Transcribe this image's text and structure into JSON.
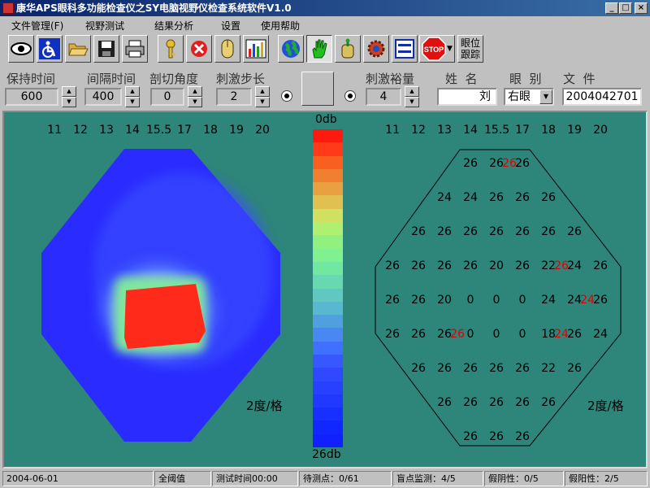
{
  "window": {
    "title": "康华APS眼科多功能检查仪之SY电脑视野仪检查系统软件V1.0",
    "minimize": "_",
    "maximize": "□",
    "close": "×"
  },
  "menu": [
    "文件管理(F)",
    "视野测试",
    "结果分析",
    "设置",
    "使用帮助"
  ],
  "toolbar": {
    "icons": [
      "eye-icon",
      "accessibility-icon",
      "open-folder-icon",
      "save-disk-icon",
      "printer-icon",
      "key-icon",
      "stop-circle-icon",
      "mouse-icon",
      "bar-chart-icon",
      "globe-icon",
      "hand-icon",
      "joystick-icon",
      "gear-icon",
      "list-icon",
      "stop-sign-icon"
    ],
    "stop_label": "STOP",
    "eye_track_label": "眼位\n跟踪"
  },
  "params": {
    "hold_time": {
      "label": "保持时间",
      "value": "600"
    },
    "interval_time": {
      "label": "间隔时间",
      "value": "400"
    },
    "cut_angle": {
      "label": "剖切角度",
      "value": "0"
    },
    "stim_step": {
      "label": "刺激步长",
      "value": "2"
    },
    "stim_margin": {
      "label": "刺激裕量",
      "value": "4"
    },
    "name": {
      "label": "姓  名",
      "value": "刘"
    },
    "eye": {
      "label": "眼  别",
      "value": "右眼"
    },
    "file": {
      "label": "文  件",
      "value": "2004042701"
    }
  },
  "chart": {
    "scale_top": "0db",
    "scale_bottom": "26db",
    "unit_label": "2度/格",
    "column_labels": [
      "11",
      "12",
      "13",
      "14",
      "15.5",
      "17",
      "18",
      "19",
      "20"
    ],
    "colors": {
      "background": "#2e857a",
      "field": "#1e3cff",
      "defect": "#ff2a1a"
    }
  },
  "values": [
    {
      "c": 3,
      "r": 0,
      "t": "26"
    },
    {
      "c": 4,
      "r": 0,
      "t": "26"
    },
    {
      "c": 4.5,
      "r": 0,
      "t": "26",
      "red": true
    },
    {
      "c": 5,
      "r": 0,
      "t": "26"
    },
    {
      "c": 2,
      "r": 1,
      "t": "24"
    },
    {
      "c": 3,
      "r": 1,
      "t": "24"
    },
    {
      "c": 4,
      "r": 1,
      "t": "26"
    },
    {
      "c": 5,
      "r": 1,
      "t": "26"
    },
    {
      "c": 6,
      "r": 1,
      "t": "26"
    },
    {
      "c": 1,
      "r": 2,
      "t": "26"
    },
    {
      "c": 2,
      "r": 2,
      "t": "26"
    },
    {
      "c": 3,
      "r": 2,
      "t": "26"
    },
    {
      "c": 4,
      "r": 2,
      "t": "26"
    },
    {
      "c": 5,
      "r": 2,
      "t": "26"
    },
    {
      "c": 6,
      "r": 2,
      "t": "26"
    },
    {
      "c": 7,
      "r": 2,
      "t": "26"
    },
    {
      "c": 0,
      "r": 3,
      "t": "26"
    },
    {
      "c": 1,
      "r": 3,
      "t": "26"
    },
    {
      "c": 2,
      "r": 3,
      "t": "26"
    },
    {
      "c": 3,
      "r": 3,
      "t": "26"
    },
    {
      "c": 4,
      "r": 3,
      "t": "20"
    },
    {
      "c": 5,
      "r": 3,
      "t": "26"
    },
    {
      "c": 6,
      "r": 3,
      "t": "22"
    },
    {
      "c": 6.5,
      "r": 3,
      "t": "26",
      "red": true
    },
    {
      "c": 7,
      "r": 3,
      "t": "24"
    },
    {
      "c": 8,
      "r": 3,
      "t": "26"
    },
    {
      "c": 0,
      "r": 4,
      "t": "26"
    },
    {
      "c": 1,
      "r": 4,
      "t": "26"
    },
    {
      "c": 2,
      "r": 4,
      "t": "20"
    },
    {
      "c": 3,
      "r": 4,
      "t": "0"
    },
    {
      "c": 4,
      "r": 4,
      "t": "0"
    },
    {
      "c": 5,
      "r": 4,
      "t": "0"
    },
    {
      "c": 6,
      "r": 4,
      "t": "24"
    },
    {
      "c": 7,
      "r": 4,
      "t": "24"
    },
    {
      "c": 7.5,
      "r": 4,
      "t": "24",
      "red": true
    },
    {
      "c": 8,
      "r": 4,
      "t": "26"
    },
    {
      "c": 0,
      "r": 5,
      "t": "26"
    },
    {
      "c": 1,
      "r": 5,
      "t": "26"
    },
    {
      "c": 2,
      "r": 5,
      "t": "26"
    },
    {
      "c": 2.5,
      "r": 5,
      "t": "26",
      "red": true
    },
    {
      "c": 3,
      "r": 5,
      "t": "0"
    },
    {
      "c": 4,
      "r": 5,
      "t": "0"
    },
    {
      "c": 5,
      "r": 5,
      "t": "0"
    },
    {
      "c": 6,
      "r": 5,
      "t": "18"
    },
    {
      "c": 6.5,
      "r": 5,
      "t": "24",
      "red": true
    },
    {
      "c": 7,
      "r": 5,
      "t": "26"
    },
    {
      "c": 8,
      "r": 5,
      "t": "24"
    },
    {
      "c": 1,
      "r": 6,
      "t": "26"
    },
    {
      "c": 2,
      "r": 6,
      "t": "26"
    },
    {
      "c": 3,
      "r": 6,
      "t": "26"
    },
    {
      "c": 4,
      "r": 6,
      "t": "26"
    },
    {
      "c": 5,
      "r": 6,
      "t": "26"
    },
    {
      "c": 6,
      "r": 6,
      "t": "22"
    },
    {
      "c": 7,
      "r": 6,
      "t": "26"
    },
    {
      "c": 2,
      "r": 7,
      "t": "26"
    },
    {
      "c": 3,
      "r": 7,
      "t": "26"
    },
    {
      "c": 4,
      "r": 7,
      "t": "26"
    },
    {
      "c": 5,
      "r": 7,
      "t": "26"
    },
    {
      "c": 6,
      "r": 7,
      "t": "26"
    },
    {
      "c": 3,
      "r": 8,
      "t": "26"
    },
    {
      "c": 4,
      "r": 8,
      "t": "26"
    },
    {
      "c": 5,
      "r": 8,
      "t": "26"
    }
  ],
  "status": {
    "date": "2004-06-01",
    "mode": "全阈值",
    "test_time": "测试时间00:00",
    "pending": "待测点：0/61",
    "blind_spot": "盲点监测：4/5",
    "false_neg": "假阴性：0/5",
    "false_pos": "假阳性：2/5"
  }
}
